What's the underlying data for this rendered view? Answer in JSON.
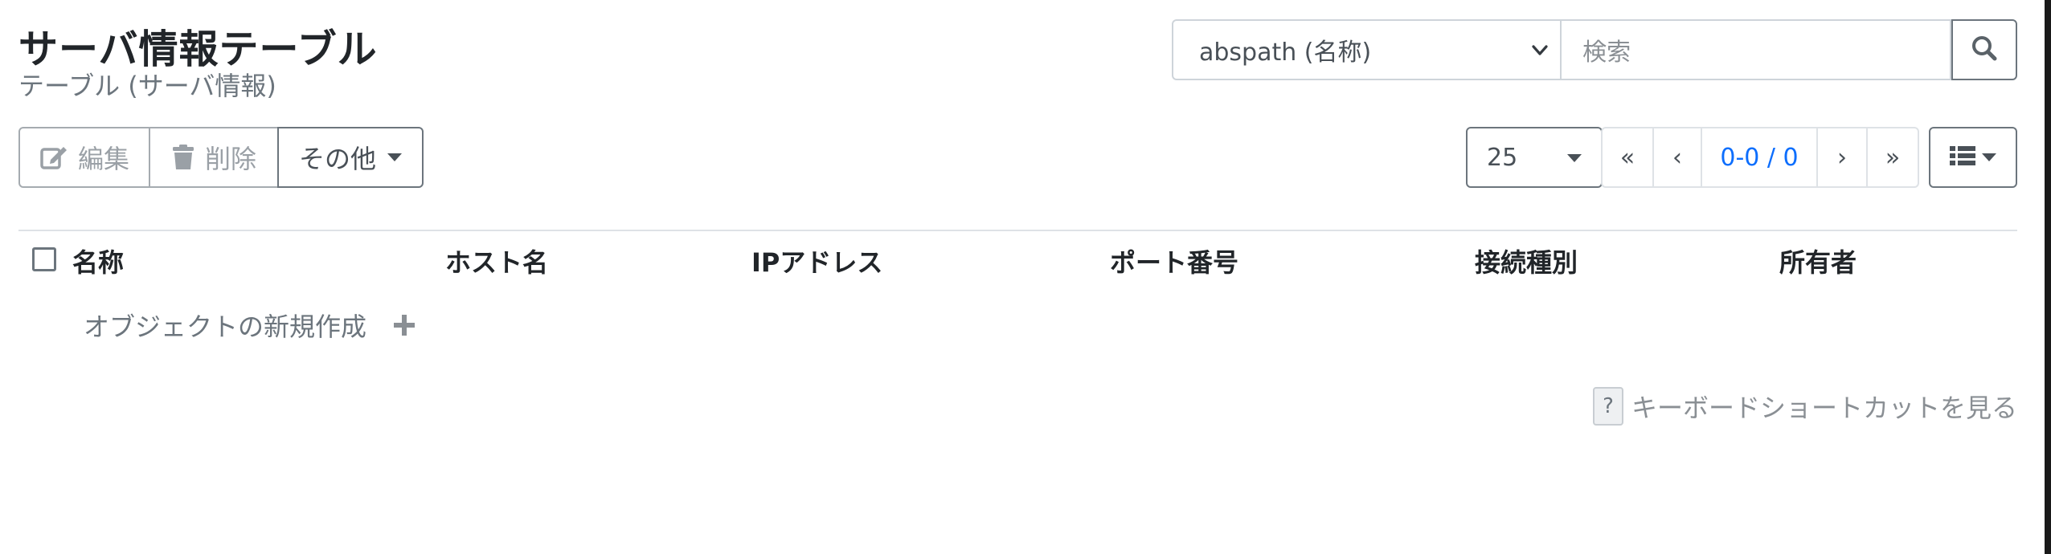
{
  "header": {
    "title": "サーバ情報テーブル",
    "subtitle": "テーブル (サーバ情報)"
  },
  "search": {
    "field_selected": "abspath (名称)",
    "placeholder": "検索",
    "button_icon": "search-icon"
  },
  "toolbar": {
    "edit_label": "編集",
    "delete_label": "削除",
    "other_label": "その他",
    "edit_icon": "edit-icon",
    "delete_icon": "trash-icon"
  },
  "pagination": {
    "page_size": "25",
    "first": "«",
    "prev": "‹",
    "info": "0-0 / 0",
    "next": "›",
    "last": "»",
    "view_icon": "list-view-icon"
  },
  "table": {
    "columns": [
      "名称",
      "ホスト名",
      "IPアドレス",
      "ポート番号",
      "接続種別",
      "所有者"
    ],
    "rows": []
  },
  "new_object": {
    "label": "オブジェクトの新規作成",
    "icon": "plus-icon"
  },
  "shortcut_help": {
    "key": "?",
    "label": "キーボードショートカットを見る"
  },
  "colors": {
    "accent": "#0d6efd",
    "text": "#212529",
    "muted": "#6c757d",
    "border": "#dee2e6"
  }
}
